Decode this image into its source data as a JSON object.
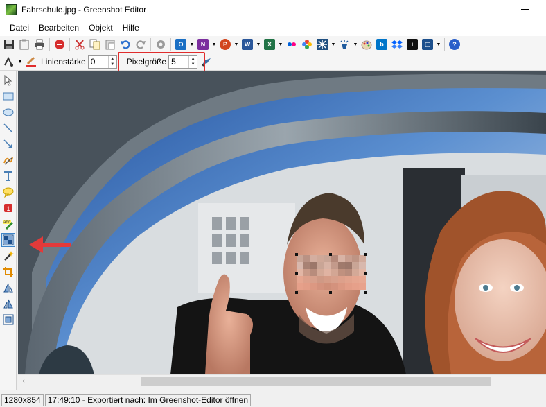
{
  "window": {
    "title": "Fahrschule.jpg - Greenshot Editor"
  },
  "menu": [
    "Datei",
    "Bearbeiten",
    "Objekt",
    "Hilfe"
  ],
  "toolbar1": {
    "icons": [
      "save-icon",
      "clipboard-icon",
      "print-icon",
      "delete-icon",
      "cut-icon",
      "copy-icon",
      "paste-icon",
      "undo-icon",
      "redo-icon",
      "settings-icon",
      "outlook-icon",
      "onenote-icon",
      "powerpoint-icon",
      "word-icon",
      "excel-icon",
      "flickr-icon",
      "photos-icon",
      "jira-icon",
      "lamp-icon",
      "paint-icon",
      "box-icon",
      "dropbox-icon",
      "imgur-icon",
      "external-icon",
      "help-icon"
    ]
  },
  "toolbar2": {
    "line_width_label": "Linienstärke",
    "line_width_value": "0",
    "pixel_size_label": "Pixelgröße",
    "pixel_size_value": "5"
  },
  "tools": [
    "cursor-icon",
    "rectangle-icon",
    "ellipse-icon",
    "line-icon",
    "arrow-icon",
    "freehand-icon",
    "text-icon",
    "speechbubble-icon",
    "counter-icon",
    "highlight-icon",
    "obfuscate-icon",
    "effects-icon",
    "crop-icon",
    "rotate-cw-icon",
    "rotate-ccw-icon",
    "resize-icon"
  ],
  "active_tool": "obfuscate-icon",
  "statusbar": {
    "dimensions": "1280x854",
    "message": "17:49:10 - Exportiert nach: Im Greenshot-Editor öffnen"
  },
  "colors": {
    "highlight_red": "#e02d2d",
    "line_color": "#e02d2d",
    "active_tool_bg": "#cce4f7"
  }
}
